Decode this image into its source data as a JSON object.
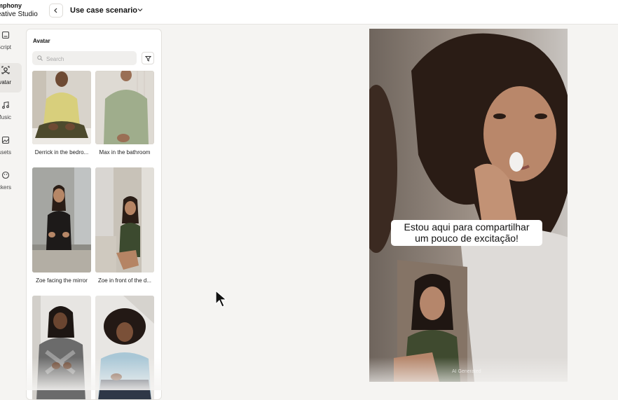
{
  "header": {
    "brand_line1": "mphony",
    "brand_line2": "eative Studio",
    "page_title": "Use case scenario"
  },
  "sidebar": {
    "items": [
      {
        "label": "Script",
        "icon": "script-icon"
      },
      {
        "label": "Avatar",
        "icon": "avatar-icon",
        "active": true
      },
      {
        "label": "Music",
        "icon": "music-icon"
      },
      {
        "label": "Assets",
        "icon": "assets-icon"
      },
      {
        "label": "Stickers",
        "icon": "stickers-icon"
      }
    ]
  },
  "avatar_panel": {
    "title": "Avatar",
    "search_placeholder": "Search",
    "avatars": [
      {
        "name": "Derrick in the bedro..."
      },
      {
        "name": "Max in the bathroom"
      },
      {
        "name": "Zoe facing the mirror"
      },
      {
        "name": "Zoe in front of the d..."
      },
      {
        "name": ""
      },
      {
        "name": ""
      }
    ]
  },
  "preview": {
    "caption_line1": "Estou aqui para compartilhar",
    "caption_line2": "um pouco de excitação!",
    "watermark": "AI Generated"
  },
  "colors": {
    "background": "#f5f4f2",
    "panel": "#ffffff",
    "active_rail": "#e9e7e4"
  }
}
